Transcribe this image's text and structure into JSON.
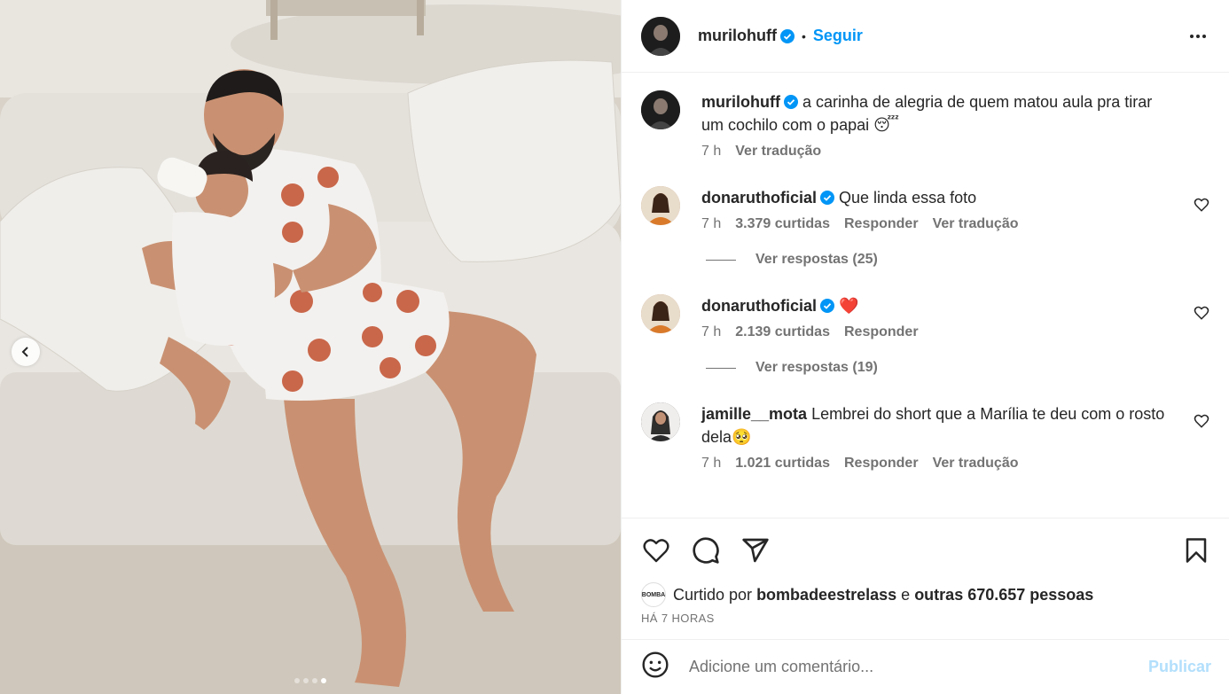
{
  "post": {
    "username": "murilohuff",
    "separator": "•",
    "follow_label": "Seguir"
  },
  "caption": {
    "username": "murilohuff",
    "text": "a carinha de alegria de quem matou aula pra tirar um cochilo com o papai 😴",
    "time": "7 h",
    "translate": "Ver tradução"
  },
  "comments": [
    {
      "username": "donaruthoficial",
      "text": "Que linda essa foto",
      "time": "7 h",
      "likes": "3.379 curtidas",
      "reply": "Responder",
      "translate": "Ver tradução",
      "replies": "Ver respostas (25)"
    },
    {
      "username": "donaruthoficial",
      "text": "❤️",
      "time": "7 h",
      "likes": "2.139 curtidas",
      "reply": "Responder",
      "replies": "Ver respostas (19)"
    },
    {
      "username": "jamille__mota",
      "text": "Lembrei do short que a Marília te deu com o rosto dela🥺",
      "time": "7 h",
      "likes": "1.021 curtidas",
      "reply": "Responder",
      "translate": "Ver tradução"
    }
  ],
  "likes": {
    "prefix": "Curtido por",
    "user": "bombadeestrelass",
    "conj": "e",
    "others": "outras 670.657 pessoas",
    "mini_avatar_text": "BOMBA"
  },
  "posted_ago": "HÁ 7 HORAS",
  "comment_input": {
    "placeholder": "Adicione um comentário...",
    "publish": "Publicar"
  },
  "carousel": {
    "total": 4,
    "active": 4
  },
  "colors": {
    "accent": "#0095f6",
    "verified": "#0095f6",
    "muted": "#737373",
    "publish_disabled": "#b2dffc",
    "heart": "#ed4956"
  },
  "icons": [
    "chevron-left-icon",
    "more-icon",
    "verified-icon",
    "heart-icon",
    "comment-icon",
    "share-icon",
    "bookmark-icon",
    "emoji-icon"
  ]
}
